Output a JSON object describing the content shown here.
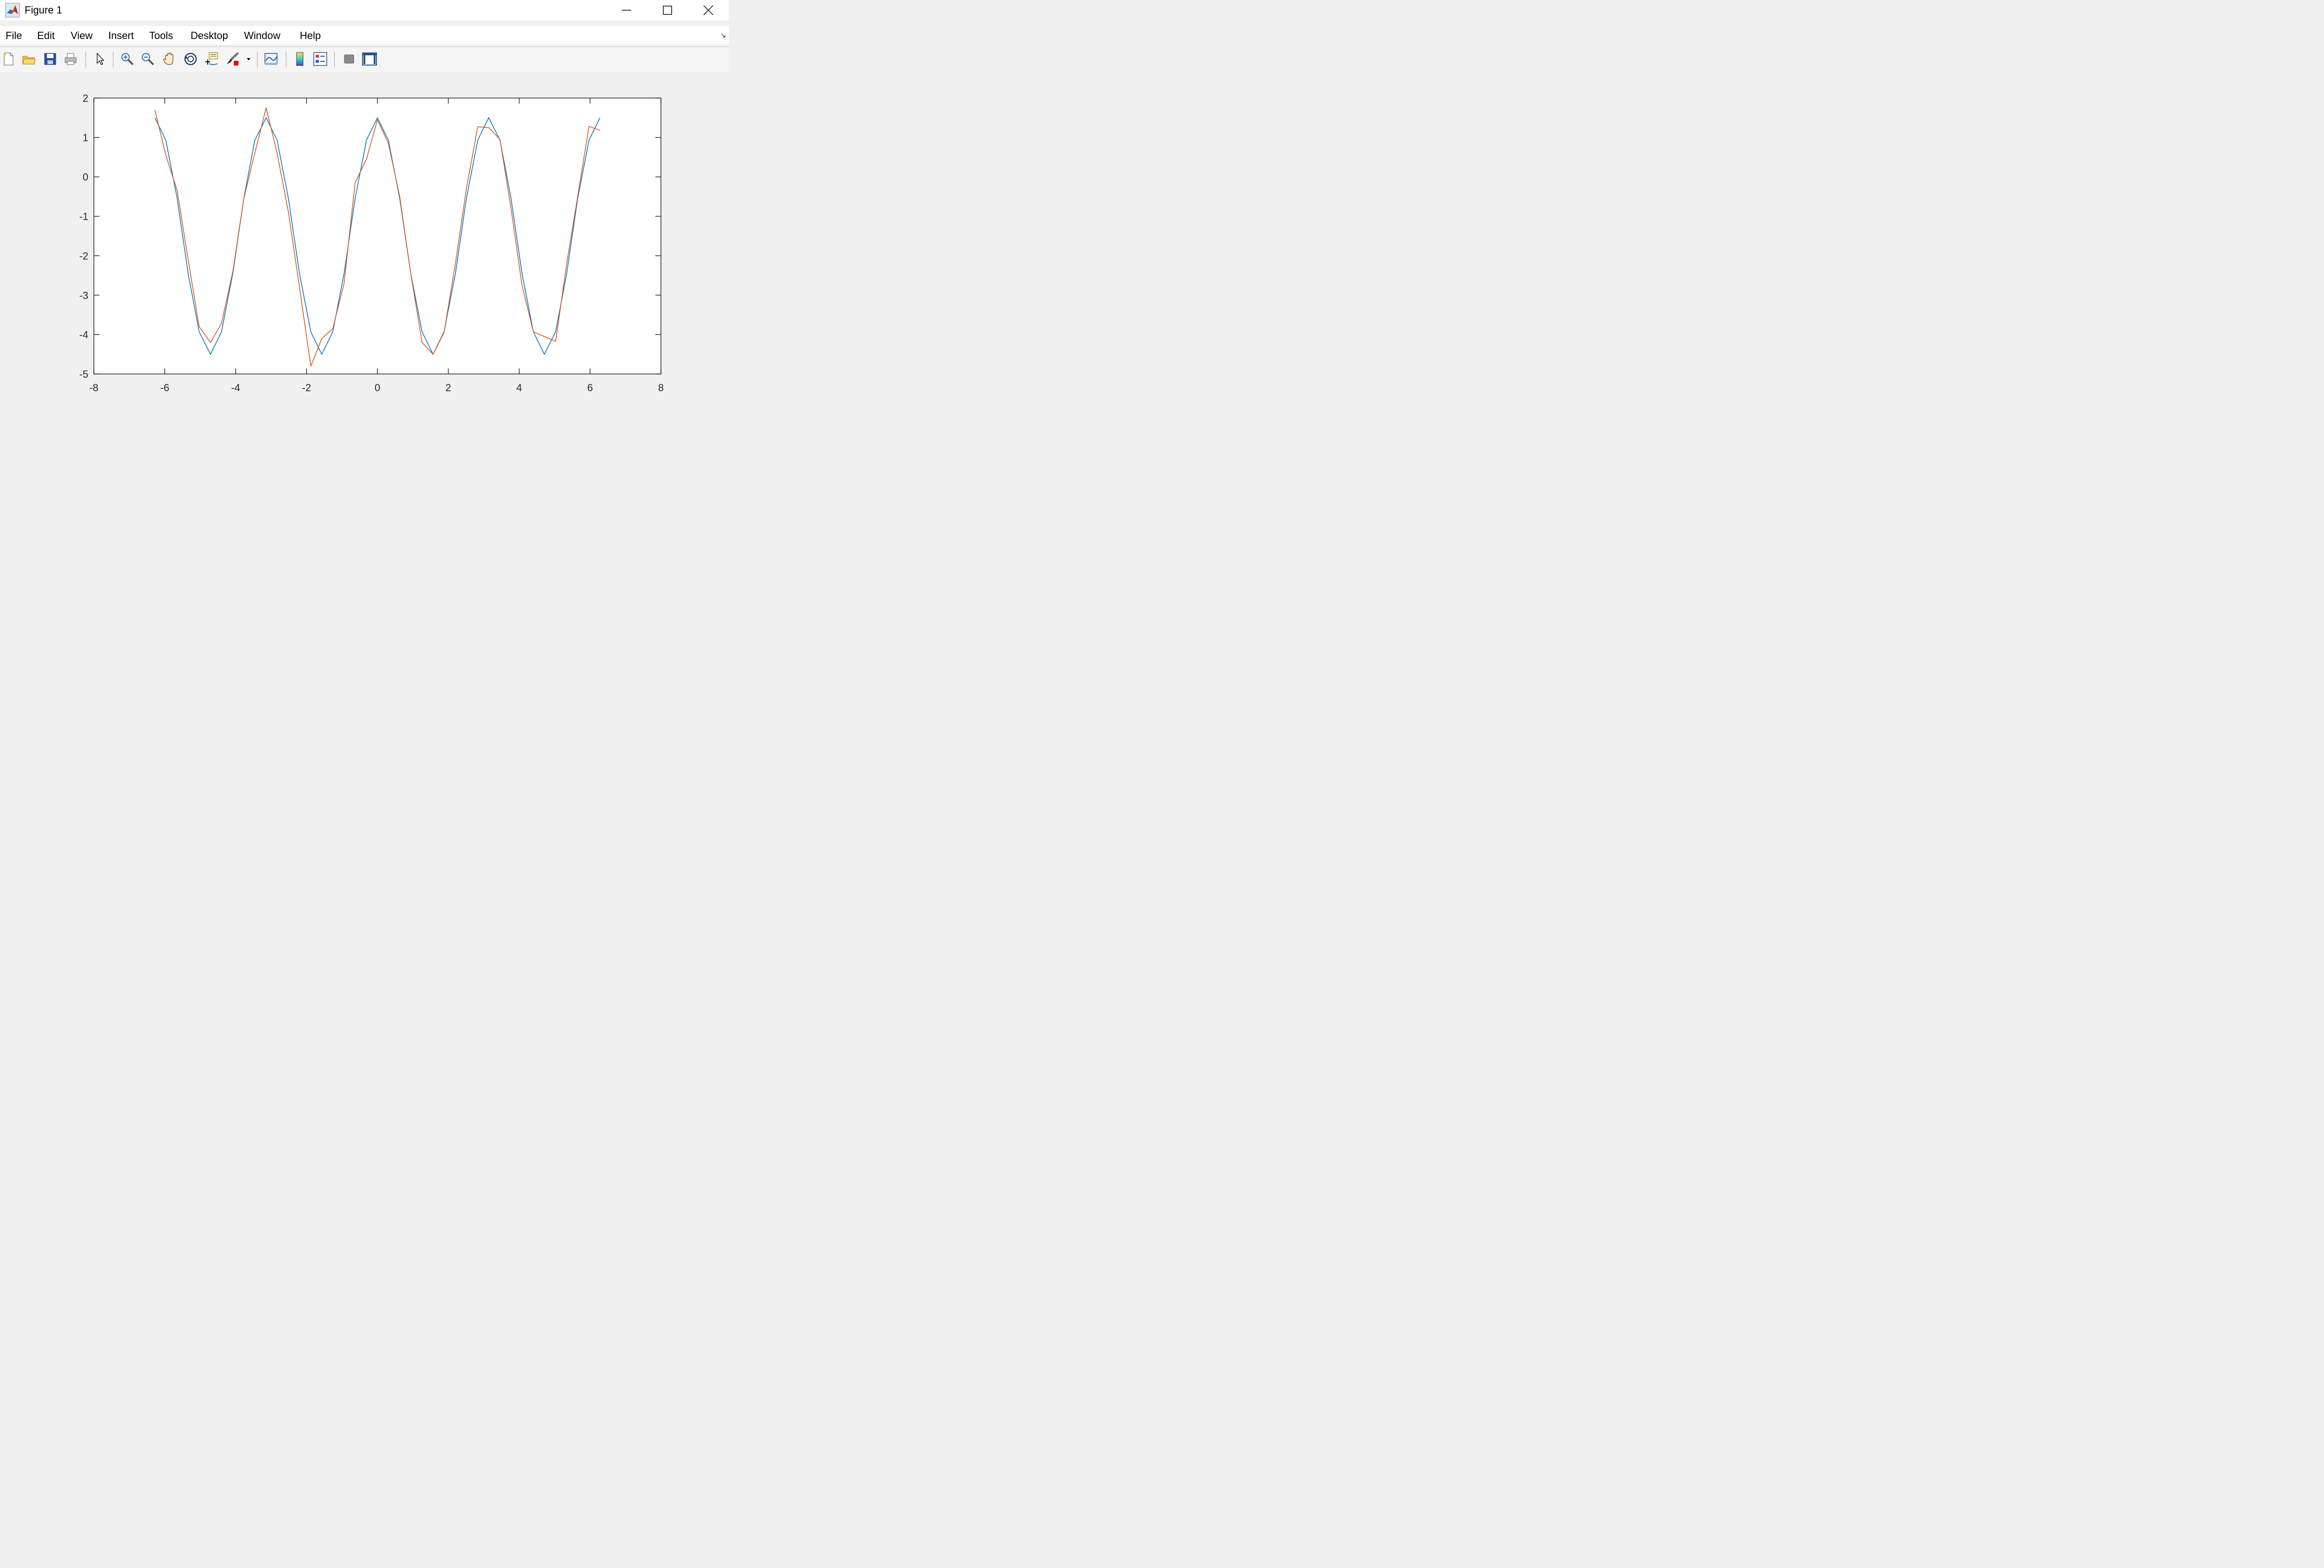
{
  "window": {
    "title": "Figure 1",
    "icons": {
      "app": "matlab-icon",
      "minimize": "minimize-icon",
      "maximize": "maximize-icon",
      "close": "close-icon"
    }
  },
  "menubar": {
    "items": [
      "File",
      "Edit",
      "View",
      "Insert",
      "Tools",
      "Desktop",
      "Window",
      "Help"
    ]
  },
  "toolbar": {
    "buttons": [
      "new-figure-icon",
      "open-file-icon",
      "save-icon",
      "print-icon",
      "edit-plot-icon",
      "zoom-in-icon",
      "zoom-out-icon",
      "pan-icon",
      "rotate-3d-icon",
      "data-cursor-icon",
      "brush-icon",
      "link-plot-icon",
      "colorbar-icon",
      "legend-icon",
      "hide-plot-tools-icon",
      "show-plot-tools-icon"
    ]
  },
  "colors": {
    "series1": "#0072BD",
    "series2": "#D95319",
    "axes": "#262626",
    "plot_bg": "#ffffff",
    "figure_bg": "#f0f0f0"
  },
  "chart_data": {
    "type": "line",
    "title": "",
    "xlabel": "",
    "ylabel": "",
    "xlim": [
      -8,
      8
    ],
    "ylim": [
      -5,
      2
    ],
    "xticks": [
      "-8",
      "-6",
      "-4",
      "-2",
      "0",
      "2",
      "4",
      "6",
      "8"
    ],
    "yticks": [
      "2",
      "1",
      "0",
      "-1",
      "-2",
      "-3",
      "-4",
      "-5"
    ],
    "grid": false,
    "box": true,
    "series": [
      {
        "color": "#0072BD",
        "x": [
          -6.28,
          -5.97,
          -5.65,
          -5.34,
          -5.03,
          -4.71,
          -4.4,
          -4.08,
          -3.77,
          -3.46,
          -3.14,
          -2.83,
          -2.51,
          -2.2,
          -1.88,
          -1.57,
          -1.26,
          -0.94,
          -0.63,
          -0.31,
          0.0,
          0.31,
          0.63,
          0.94,
          1.26,
          1.57,
          1.88,
          2.2,
          2.51,
          2.83,
          3.14,
          3.46,
          3.77,
          4.08,
          4.4,
          4.71,
          5.03,
          5.34,
          5.65,
          5.97,
          6.28
        ],
        "y": [
          1.5,
          0.93,
          -0.55,
          -2.45,
          -3.93,
          -4.5,
          -3.93,
          -2.45,
          -0.55,
          0.93,
          1.5,
          0.93,
          -0.55,
          -2.45,
          -3.93,
          -4.5,
          -3.93,
          -2.45,
          -0.55,
          0.93,
          1.5,
          0.93,
          -0.55,
          -2.45,
          -3.93,
          -4.5,
          -3.93,
          -2.45,
          -0.55,
          0.93,
          1.5,
          0.93,
          -0.55,
          -2.45,
          -3.93,
          -4.5,
          -3.93,
          -2.45,
          -0.55,
          0.93,
          1.5
        ]
      },
      {
        "color": "#D95319",
        "x": [
          -6.28,
          -5.97,
          -5.65,
          -5.34,
          -5.03,
          -4.71,
          -4.4,
          -4.08,
          -3.77,
          -3.46,
          -3.14,
          -2.83,
          -2.51,
          -2.2,
          -1.88,
          -1.57,
          -1.26,
          -0.94,
          -0.63,
          -0.31,
          0.0,
          0.31,
          0.63,
          0.94,
          1.26,
          1.57,
          1.88,
          2.2,
          2.51,
          2.83,
          3.14,
          3.46,
          3.77,
          4.08,
          4.4,
          4.71,
          5.03,
          5.34,
          5.65,
          5.97,
          6.28
        ],
        "y": [
          1.7,
          0.55,
          -0.35,
          -2.1,
          -3.8,
          -4.2,
          -3.72,
          -2.4,
          -0.55,
          0.6,
          1.75,
          0.6,
          -0.9,
          -2.8,
          -4.8,
          -4.1,
          -3.85,
          -2.7,
          -0.15,
          0.45,
          1.45,
          0.85,
          -0.5,
          -2.45,
          -4.2,
          -4.5,
          -3.95,
          -2.2,
          -0.3,
          1.27,
          1.25,
          0.95,
          -0.8,
          -2.75,
          -3.93,
          -4.05,
          -4.17,
          -2.2,
          -0.5,
          1.28,
          1.18
        ]
      }
    ]
  }
}
